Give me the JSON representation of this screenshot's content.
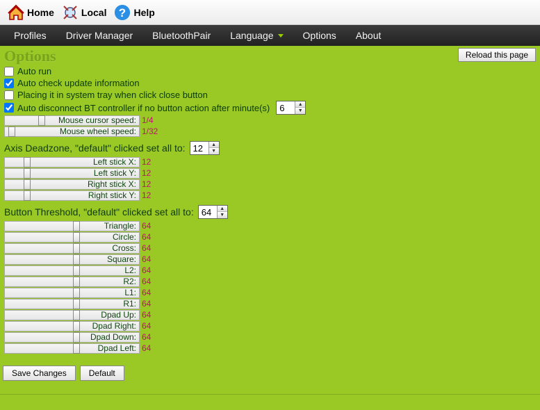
{
  "header": {
    "home": "Home",
    "local": "Local",
    "help": "Help"
  },
  "menu": {
    "profiles": "Profiles",
    "driver_manager": "Driver Manager",
    "bluetooth_pair": "BluetoothPair",
    "language": "Language",
    "options": "Options",
    "about": "About"
  },
  "reload": "Reload this page",
  "title": "Options",
  "checks": {
    "auto_run": {
      "label": "Auto run",
      "checked": false
    },
    "auto_update": {
      "label": "Auto check update information",
      "checked": true
    },
    "sys_tray": {
      "label": "Placing it in system tray when click close button",
      "checked": false
    },
    "auto_disconnect": {
      "label": "Auto disconnect BT controller if no button action after minute(s)",
      "checked": true,
      "value": "6"
    }
  },
  "mouse": {
    "cursor": {
      "label": "Mouse cursor speed:",
      "value": "1/4",
      "pos": 48
    },
    "wheel": {
      "label": "Mouse wheel speed:",
      "value": "1/32",
      "pos": 5
    }
  },
  "axis": {
    "heading": "Axis Deadzone, \"default\" clicked set all to:",
    "all": "12",
    "rows": [
      {
        "label": "Left stick X:",
        "value": "12",
        "pos": 27
      },
      {
        "label": "Left stick Y:",
        "value": "12",
        "pos": 27
      },
      {
        "label": "Right stick X:",
        "value": "12",
        "pos": 27
      },
      {
        "label": "Right stick Y:",
        "value": "12",
        "pos": 27
      }
    ]
  },
  "threshold": {
    "heading": "Button Threshold, \"default\" clicked set all to:",
    "all": "64",
    "rows": [
      {
        "label": "Triangle:",
        "value": "64",
        "pos": 98
      },
      {
        "label": "Circle:",
        "value": "64",
        "pos": 98
      },
      {
        "label": "Cross:",
        "value": "64",
        "pos": 98
      },
      {
        "label": "Square:",
        "value": "64",
        "pos": 98
      },
      {
        "label": "L2:",
        "value": "64",
        "pos": 98
      },
      {
        "label": "R2:",
        "value": "64",
        "pos": 98
      },
      {
        "label": "L1:",
        "value": "64",
        "pos": 98
      },
      {
        "label": "R1:",
        "value": "64",
        "pos": 98
      },
      {
        "label": "Dpad Up:",
        "value": "64",
        "pos": 98
      },
      {
        "label": "Dpad Right:",
        "value": "64",
        "pos": 98
      },
      {
        "label": "Dpad Down:",
        "value": "64",
        "pos": 98
      },
      {
        "label": "Dpad Left:",
        "value": "64",
        "pos": 98
      }
    ]
  },
  "buttons": {
    "save": "Save Changes",
    "default": "Default"
  }
}
